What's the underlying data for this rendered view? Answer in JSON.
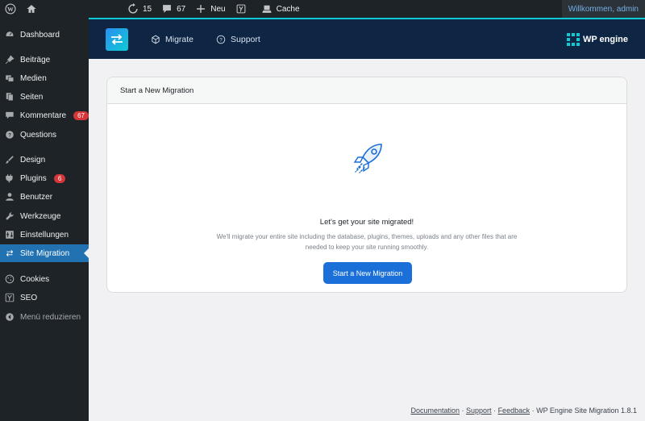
{
  "adminbar": {
    "updates_count": "15",
    "comments_count": "67",
    "new_label": "Neu",
    "cache_label": "Cache",
    "welcome": "Willkommen, admin"
  },
  "sidebar": {
    "items": [
      {
        "label": "Dashboard",
        "icon": "dashboard-icon"
      },
      {
        "label": "Beiträge",
        "icon": "pin-icon"
      },
      {
        "label": "Medien",
        "icon": "media-icon"
      },
      {
        "label": "Seiten",
        "icon": "pages-icon"
      },
      {
        "label": "Kommentare",
        "icon": "comment-icon",
        "badge": "67"
      },
      {
        "label": "Questions",
        "icon": "question-icon"
      },
      {
        "label": "Design",
        "icon": "brush-icon"
      },
      {
        "label": "Plugins",
        "icon": "plugin-icon",
        "badge": "6"
      },
      {
        "label": "Benutzer",
        "icon": "user-icon"
      },
      {
        "label": "Werkzeuge",
        "icon": "wrench-icon"
      },
      {
        "label": "Einstellungen",
        "icon": "settings-icon"
      },
      {
        "label": "Site Migration",
        "icon": "migration-icon"
      },
      {
        "label": "Cookies",
        "icon": "cookie-icon"
      },
      {
        "label": "SEO",
        "icon": "seo-icon"
      },
      {
        "label": "Menü reduzieren",
        "icon": "collapse-icon"
      }
    ]
  },
  "plugin_header": {
    "nav_migrate": "Migrate",
    "nav_support": "Support",
    "brand": "WP engine"
  },
  "card": {
    "title": "Start a New Migration",
    "headline": "Let's get your site migrated!",
    "desc_line1": "We'll migrate your entire site including the database, plugins, themes, uploads and any other files that are",
    "desc_line2": "needed to keep your site running smoothly.",
    "button": "Start a New Migration"
  },
  "footer": {
    "documentation": "Documentation",
    "support": "Support",
    "feedback": "Feedback",
    "sep": " · ",
    "version": "WP Engine Site Migration 1.8.1"
  },
  "colors": {
    "admin_bg": "#1d2327",
    "active": "#2271b1",
    "header_bg": "#0e2644",
    "button": "#1a6fd8"
  }
}
